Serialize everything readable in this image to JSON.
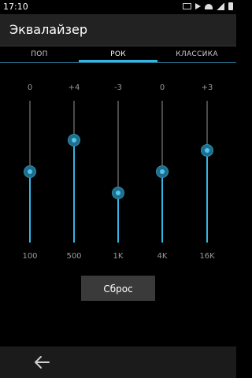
{
  "status": {
    "time": "17:10"
  },
  "app": {
    "title": "Эквалайзер"
  },
  "tabs": [
    {
      "label": "ПОП",
      "active": false
    },
    {
      "label": "РОК",
      "active": true
    },
    {
      "label": "КЛАССИКА",
      "active": false
    }
  ],
  "equalizer": {
    "range": [
      -15,
      15
    ],
    "bands": [
      {
        "value_label": "0",
        "freq_label": "100",
        "level": 0.5
      },
      {
        "value_label": "+4",
        "freq_label": "500",
        "level": 0.72
      },
      {
        "value_label": "-3",
        "freq_label": "1K",
        "level": 0.35
      },
      {
        "value_label": "0",
        "freq_label": "4K",
        "level": 0.5
      },
      {
        "value_label": "+3",
        "freq_label": "16K",
        "level": 0.65
      }
    ]
  },
  "reset_label": "Сброс",
  "colors": {
    "accent": "#33b5e5",
    "actionbar": "#222222",
    "button": "#3a3a3a"
  }
}
